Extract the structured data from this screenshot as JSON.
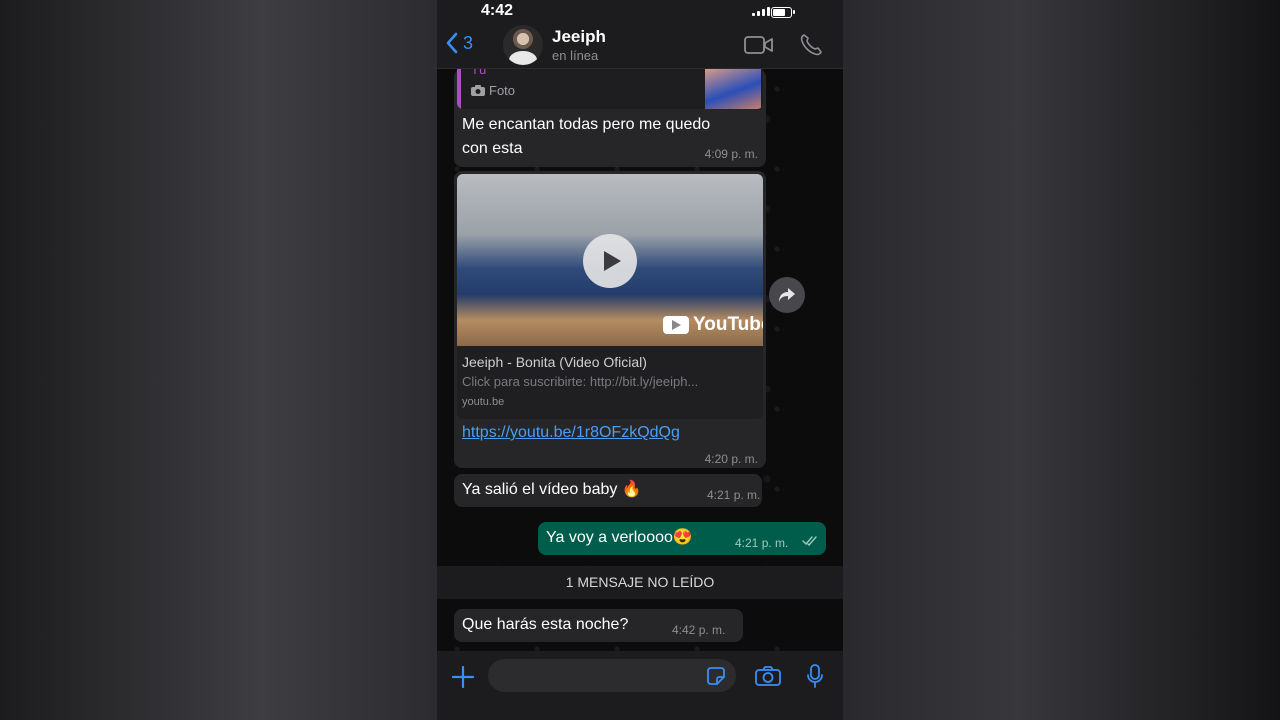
{
  "status_bar": {
    "time": "4:42"
  },
  "header": {
    "back_count": "3",
    "contact_name": "Jeeiph",
    "contact_status": "en línea"
  },
  "messages": {
    "quote": {
      "author": "Tú",
      "label": "Foto"
    },
    "m1": {
      "text_line1": "Me encantan todas pero me quedo",
      "text_line2": "con esta",
      "time": "4:09 p. m."
    },
    "m2": {
      "preview_title": "Jeeiph - Bonita  (Video Oficial)",
      "preview_desc": "Click para suscribirte: http://bit.ly/jeeiph...",
      "preview_domain": "youtu.be",
      "youtube_logo": "YouTube",
      "link": "https://youtu.be/1r8OFzkQdQg",
      "time": "4:20 p. m."
    },
    "m3": {
      "text": "Ya salió el vídeo baby 🔥",
      "time": "4:21 p. m."
    },
    "m4": {
      "text": "Ya voy a verloooo😍",
      "time": "4:21 p. m."
    },
    "unread_banner": "1 MENSAJE NO LEÍDO",
    "m5": {
      "text": "Que harás esta noche?",
      "time": "4:42 p. m."
    }
  },
  "input": {
    "placeholder": ""
  },
  "colors": {
    "accent": "#3a8ef6",
    "outgoing_bubble": "#005c4b",
    "incoming_bubble": "#262628",
    "quote_accent": "#b04ac9",
    "link": "#4a9ff5"
  },
  "icons": [
    "chevron-left-icon",
    "video-call-icon",
    "phone-icon",
    "camera-icon",
    "forward-icon",
    "play-icon",
    "plus-icon",
    "sticker-icon",
    "microphone-icon",
    "double-check-icon"
  ]
}
